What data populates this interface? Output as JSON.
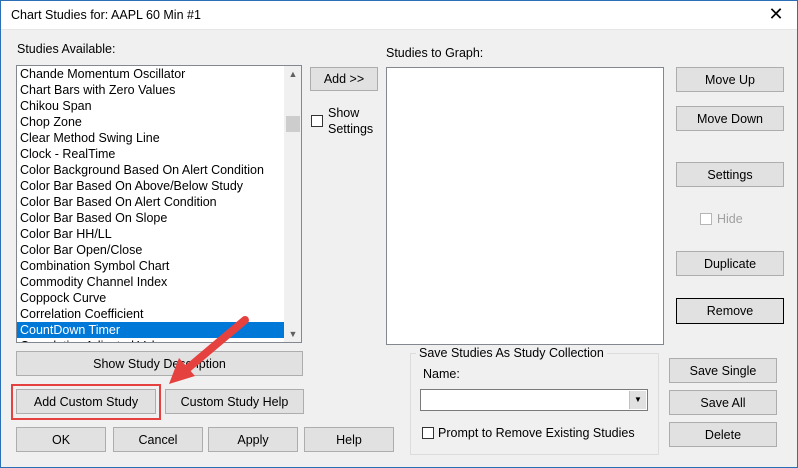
{
  "window": {
    "title": "Chart Studies for: AAPL  60 Min  #1",
    "close_glyph": "✕"
  },
  "studies_available": {
    "label": "Studies Available:",
    "items": [
      "Chande Momentum Oscillator",
      "Chart Bars with Zero Values",
      "Chikou Span",
      "Chop Zone",
      "Clear Method Swing Line",
      "Clock - RealTime",
      "Color Background Based On Alert Condition",
      "Color Bar Based On Above/Below Study",
      "Color Bar Based On Alert Condition",
      "Color Bar Based On Slope",
      "Color Bar HH/LL",
      "Color Bar Open/Close",
      "Combination Symbol Chart",
      "Commodity Channel Index",
      "Coppock Curve",
      "Correlation Coefficient",
      "CountDown Timer",
      "Cumulative Adjusted Value"
    ],
    "selected_index": 16
  },
  "middle": {
    "add_label": "Add >>",
    "show_settings_label_line1": "Show",
    "show_settings_label_line2": "Settings"
  },
  "studies_to_graph": {
    "label": "Studies to Graph:"
  },
  "right_buttons": {
    "move_up": "Move Up",
    "move_down": "Move Down",
    "settings": "Settings",
    "hide": "Hide",
    "duplicate": "Duplicate",
    "remove": "Remove"
  },
  "bottom_left": {
    "show_study_description": "Show Study Description",
    "add_custom_study": "Add Custom Study",
    "custom_study_help": "Custom Study Help",
    "ok": "OK",
    "cancel": "Cancel",
    "apply": "Apply",
    "help": "Help"
  },
  "save_collection": {
    "group_title": "Save Studies As Study Collection",
    "name_label": "Name:",
    "name_value": "",
    "prompt_label": "Prompt to Remove Existing Studies",
    "save_single": "Save Single",
    "save_all": "Save All",
    "delete": "Delete"
  },
  "colors": {
    "selection": "#0078d7",
    "annotation": "#e5413f"
  }
}
